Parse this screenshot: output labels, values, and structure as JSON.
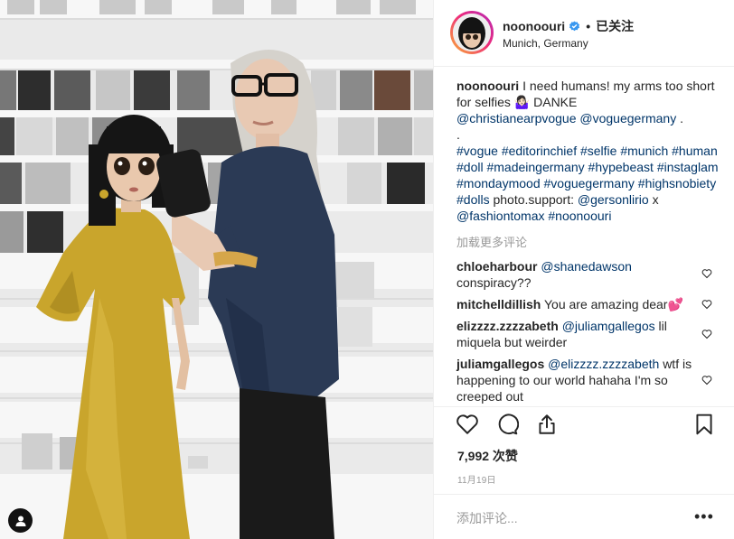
{
  "post": {
    "username": "noonoouri",
    "follow_label": "已关注",
    "dot": "•",
    "location": "Munich, Germany",
    "caption": {
      "username": "noonoouri",
      "line1": "I need humans! my arms too short for selfies 🤷🏻‍♀️ DANKE",
      "mentions": "@christianearpvogue @voguegermany",
      "mentions_tail": ".",
      "dot_line": ".",
      "hashtags": "#vogue #editorinchief #selfie #munich #human #doll #madeingermany #hypebeast #instaglam #mondaymood #voguegermany #highsnobiety #dolls",
      "support": "photo.support:",
      "credits_a": "@gersonlirio",
      "credits_x": "x",
      "credits_b": "@fashiontomax",
      "credits_c": "#noonoouri"
    },
    "load_more": "加载更多评论",
    "comments": [
      {
        "user": "chloeharbour",
        "mention": "@shanedawson",
        "text": "conspiracy??"
      },
      {
        "user": "mitchelldillish",
        "mention": "",
        "text": "You are amazing dear💕"
      },
      {
        "user": "elizzzz.zzzzabeth",
        "mention": "@juliamgallegos",
        "text": "lil miquela but weirder"
      },
      {
        "user": "juliamgallegos",
        "mention": "@elizzzz.zzzzabeth",
        "text": "wtf is happening to our world hahaha I'm so creeped out"
      }
    ],
    "likes": "7,992 次赞",
    "date": "11月19日",
    "add_comment_placeholder": "添加评论...",
    "more_label": "•••"
  },
  "icons": {
    "verified": "verified-badge-icon",
    "like": "heart-icon",
    "comment": "comment-bubble-icon",
    "share": "share-icon",
    "save": "bookmark-icon",
    "tag": "person-tag-icon",
    "colors": {
      "verified": "#3897f0",
      "gold": "#c9a52c",
      "blouse": "#2b3a55"
    }
  }
}
